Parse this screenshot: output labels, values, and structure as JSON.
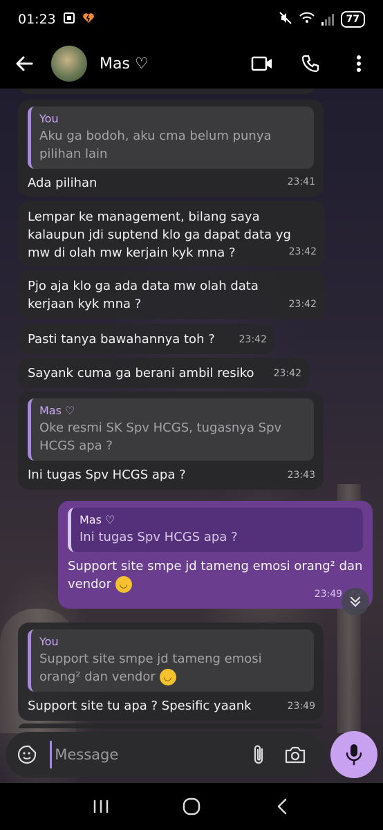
{
  "status_bar": {
    "time": "01:23",
    "battery": "77"
  },
  "header": {
    "contact_name": "Mas ♡"
  },
  "messages": [
    {
      "direction": "in",
      "quote_name": "You",
      "quote_text": "Aku ga bodoh, aku cma belum punya pilihan lain",
      "text": "Ada pilihan",
      "time": "23:41"
    },
    {
      "direction": "in",
      "text": "Lempar ke management, bilang saya kalaupun jdi suptend klo ga dapat data yg mw di olah mw kerjain kyk mna ?",
      "time": "23:42"
    },
    {
      "direction": "in",
      "text": "Pjo aja klo ga ada data mw olah data kerjaan kyk mna ?",
      "time": "23:42"
    },
    {
      "direction": "in",
      "text": "Pasti tanya bawahannya toh ?",
      "time": "23:42"
    },
    {
      "direction": "in",
      "text": "Sayank cuma ga berani ambil resiko",
      "time": "23:42"
    },
    {
      "direction": "in",
      "quote_name": "Mas ♡",
      "quote_text": "Oke resmi SK Spv HCGS, tugasnya Spv HCGS apa ?",
      "text": "Ini tugas Spv HCGS apa ?",
      "time": "23:43"
    },
    {
      "direction": "out",
      "quote_name": "Mas ♡",
      "quote_text": "Ini tugas Spv HCGS apa ?",
      "text": "Support site smpe jd tameng emosi orang² dan vendor",
      "time": "23:49"
    },
    {
      "direction": "in",
      "quote_name": "You",
      "quote_text": "Support site smpe jd tameng emosi orang² dan vendor",
      "text": "Support site tu apa ? Spesific yaank",
      "time": "23:49"
    }
  ],
  "input": {
    "placeholder": "Message"
  },
  "colors": {
    "outgoing_bubble": "#6b3d8f",
    "incoming_bubble": "#28282a",
    "mic_button": "#c8a2f0",
    "quote_bar": "#a78bd8"
  },
  "icons": [
    "back-arrow-icon",
    "video-call-icon",
    "phone-icon",
    "more-options-icon",
    "sticker-icon",
    "attach-icon",
    "camera-icon",
    "mic-icon",
    "scroll-down-icon",
    "recent-apps-icon",
    "home-icon",
    "back-nav-icon"
  ]
}
